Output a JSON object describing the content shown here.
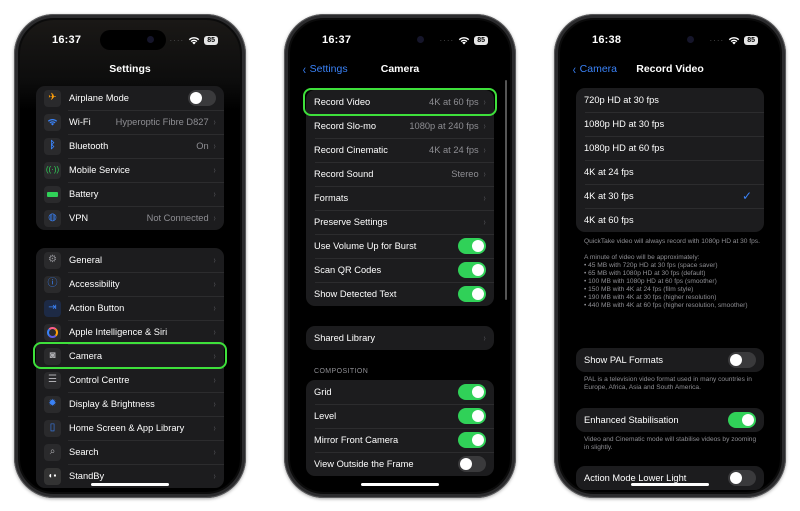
{
  "phones": [
    {
      "status": {
        "time": "16:37",
        "battery": "85"
      },
      "nav": {
        "title": "Settings"
      },
      "group1": [
        {
          "label": "Airplane Mode",
          "icon": "airplane-icon",
          "type": "toggle",
          "on": false
        },
        {
          "label": "Wi-Fi",
          "icon": "wifi-icon",
          "value": "Hyperoptic Fibre D827",
          "type": "link"
        },
        {
          "label": "Bluetooth",
          "icon": "bluetooth-icon",
          "value": "On",
          "type": "link"
        },
        {
          "label": "Mobile Service",
          "icon": "antenna-icon",
          "value": "",
          "type": "link"
        },
        {
          "label": "Battery",
          "icon": "battery-icon",
          "value": "",
          "type": "link"
        },
        {
          "label": "VPN",
          "icon": "vpn-globe-icon",
          "value": "Not Connected",
          "type": "link"
        }
      ],
      "group2": [
        {
          "label": "General",
          "icon": "gear-icon"
        },
        {
          "label": "Accessibility",
          "icon": "accessibility-icon"
        },
        {
          "label": "Action Button",
          "icon": "action-button-icon"
        },
        {
          "label": "Apple Intelligence & Siri",
          "icon": "siri-icon"
        },
        {
          "label": "Camera",
          "icon": "camera-icon",
          "highlighted": true
        },
        {
          "label": "Control Centre",
          "icon": "control-centre-icon"
        },
        {
          "label": "Display & Brightness",
          "icon": "sun-icon"
        },
        {
          "label": "Home Screen & App Library",
          "icon": "home-screen-icon"
        },
        {
          "label": "Search",
          "icon": "search-icon"
        },
        {
          "label": "StandBy",
          "icon": "standby-icon"
        }
      ]
    },
    {
      "status": {
        "time": "16:37",
        "battery": "85"
      },
      "nav": {
        "title": "Camera",
        "back": "Settings"
      },
      "group1": [
        {
          "label": "Record Video",
          "value": "4K at 60 fps",
          "type": "link",
          "highlighted": true
        },
        {
          "label": "Record Slo-mo",
          "value": "1080p at 240 fps",
          "type": "link"
        },
        {
          "label": "Record Cinematic",
          "value": "4K at 24 fps",
          "type": "link"
        },
        {
          "label": "Record Sound",
          "value": "Stereo",
          "type": "link"
        },
        {
          "label": "Formats",
          "value": "",
          "type": "link"
        },
        {
          "label": "Preserve Settings",
          "value": "",
          "type": "link"
        },
        {
          "label": "Use Volume Up for Burst",
          "type": "toggle",
          "on": true
        },
        {
          "label": "Scan QR Codes",
          "type": "toggle",
          "on": true
        },
        {
          "label": "Show Detected Text",
          "type": "toggle",
          "on": true
        }
      ],
      "group2": [
        {
          "label": "Shared Library",
          "type": "link"
        }
      ],
      "composition_header": "COMPOSITION",
      "group3": [
        {
          "label": "Grid",
          "on": true
        },
        {
          "label": "Level",
          "on": true
        },
        {
          "label": "Mirror Front Camera",
          "on": true
        },
        {
          "label": "View Outside the Frame",
          "on": false
        }
      ]
    },
    {
      "status": {
        "time": "16:38",
        "battery": "85"
      },
      "nav": {
        "title": "Record Video",
        "back": "Camera"
      },
      "formats": [
        {
          "label": "720p HD at 30 fps",
          "selected": false
        },
        {
          "label": "1080p HD at 30 fps",
          "selected": false
        },
        {
          "label": "1080p HD at 60 fps",
          "selected": false
        },
        {
          "label": "4K at 24 fps",
          "selected": false
        },
        {
          "label": "4K at 30 fps",
          "selected": true
        },
        {
          "label": "4K at 60 fps",
          "selected": false
        }
      ],
      "check_glyph": "✓",
      "formats_footer": "QuickTake video will always record with 1080p HD at 30 fps.\n\nA minute of video will be approximately:\n• 45 MB with 720p HD at 30 fps (space saver)\n• 65 MB with 1080p HD at 30 fps (default)\n• 100 MB with 1080p HD at 60 fps (smoother)\n• 150 MB with 4K at 24 fps (film style)\n• 190 MB with 4K at 30 fps (higher resolution)\n• 440 MB with 4K at 60 fps (higher resolution, smoother)",
      "pal": {
        "label": "Show PAL Formats",
        "on": false,
        "footer": "PAL is a television video format used in many countries in Europe, Africa, Asia and South America."
      },
      "stabilisation": {
        "label": "Enhanced Stabilisation",
        "on": true,
        "footer": "Video and Cinematic mode will stabilise videos by zooming in slightly."
      },
      "action_mode": {
        "label": "Action Mode Lower Light",
        "on": false
      }
    }
  ],
  "glyphs": {
    "chevron": "›",
    "back_chevron": "‹",
    "signal_dots": "····"
  },
  "colors": {
    "accent_blue": "#3a82f7",
    "toggle_on": "#30d158",
    "highlight_green": "#3ee03b"
  }
}
